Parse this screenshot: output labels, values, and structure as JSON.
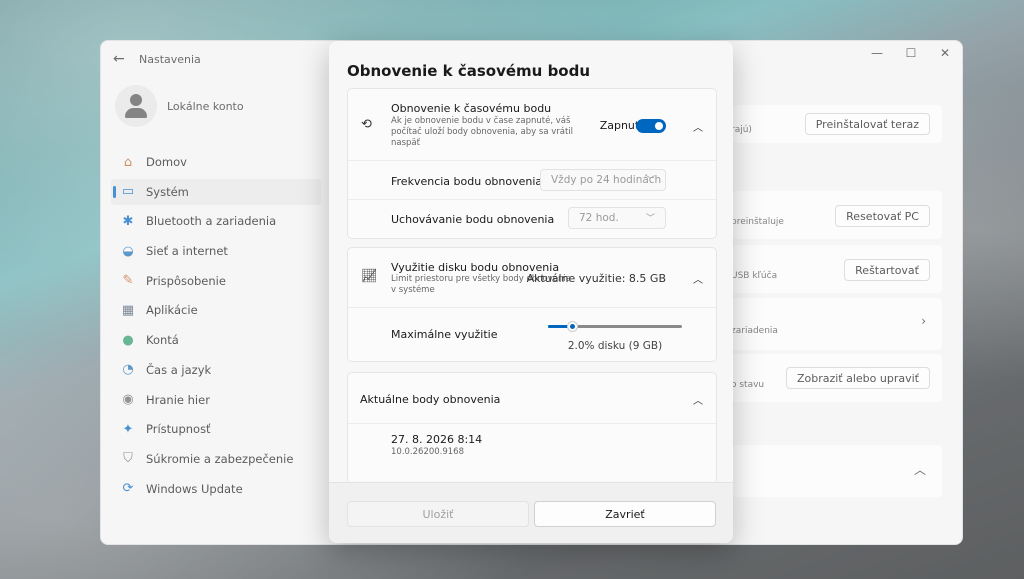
{
  "settings": {
    "app_title": "Nastavenia",
    "account_name": "Lokálne konto",
    "nav": [
      {
        "label": "Domov",
        "icon": "home-icon",
        "glyph": "⌂",
        "color": "#c0652a"
      },
      {
        "label": "Systém",
        "icon": "system-icon",
        "glyph": "▭",
        "color": "#0067c0",
        "active": true
      },
      {
        "label": "Bluetooth a zariadenia",
        "icon": "bluetooth-icon",
        "glyph": "✱",
        "color": "#0067c0"
      },
      {
        "label": "Sieť a internet",
        "icon": "wifi-icon",
        "glyph": "◒",
        "color": "#1f6fb5"
      },
      {
        "label": "Prispôsobenie",
        "icon": "brush-icon",
        "glyph": "✎",
        "color": "#c0652a"
      },
      {
        "label": "Aplikácie",
        "icon": "apps-icon",
        "glyph": "▦",
        "color": "#4a5a6a"
      },
      {
        "label": "Kontá",
        "icon": "accounts-icon",
        "glyph": "●",
        "color": "#2e9a6a"
      },
      {
        "label": "Čas a jazyk",
        "icon": "globe-clock-icon",
        "glyph": "◔",
        "color": "#1f6fb5"
      },
      {
        "label": "Hranie hier",
        "icon": "gamepad-icon",
        "glyph": "◉",
        "color": "#6a6a6a"
      },
      {
        "label": "Prístupnosť",
        "icon": "accessibility-icon",
        "glyph": "✦",
        "color": "#0067c0"
      },
      {
        "label": "Súkromie a zabezpečenie",
        "icon": "shield-icon",
        "glyph": "⛉",
        "color": "#6a6a6a"
      },
      {
        "label": "Windows Update",
        "icon": "update-icon",
        "glyph": "⟳",
        "color": "#0067c0"
      }
    ],
    "right_cards": [
      {
        "frag": "rajú)",
        "button": "Preinštalovať teraz"
      },
      {
        "frag": "preinštaluje",
        "button": "Resetovať PC"
      },
      {
        "frag": "USB kľúča",
        "button": "Reštartovať"
      },
      {
        "frag": "zariadenia",
        "button": ""
      },
      {
        "frag": "o stavu",
        "button": "Zobraziť alebo upraviť"
      }
    ]
  },
  "dialog": {
    "title": "Obnovenie k časovému bodu",
    "restore": {
      "title": "Obnovenie k časovému bodu",
      "description": "Ak je obnovenie bodu v čase zapnuté, váš počítač uloží body obnovenia, aby sa vrátil naspäť",
      "toggle_label": "Zapnuté",
      "toggle_on": true,
      "frequency_label": "Frekvencia bodu obnovenia",
      "frequency_value": "Vždy po 24 hodinách",
      "retention_label": "Uchovávanie bodu obnovenia",
      "retention_value": "72 hod."
    },
    "disk": {
      "title": "Využitie disku bodu obnovenia",
      "description": "Limit priestoru pre všetky body obnovenia v systéme",
      "current_usage": "Aktuálne využitie: 8.5 GB",
      "max_label": "Maximálne využitie",
      "slider_fraction": 0.18,
      "slider_value": "2.0% disku (9 GB)"
    },
    "points": {
      "title": "Aktuálne body obnovenia",
      "items": [
        {
          "date": "27. 8. 2026 8:14",
          "build": "10.0.26200.9168"
        }
      ]
    },
    "buttons": {
      "save": "Uložiť",
      "close": "Zavrieť"
    }
  }
}
